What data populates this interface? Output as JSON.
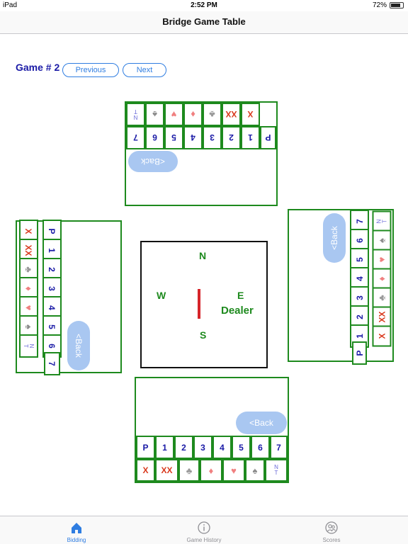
{
  "status": {
    "device": "iPad",
    "time": "2:52 PM",
    "battery": "72%"
  },
  "nav": {
    "title": "Bridge Game Table"
  },
  "game": {
    "label": "Game # 2",
    "previous": "Previous",
    "next": "Next"
  },
  "bids": {
    "numbers": [
      "P",
      "1",
      "2",
      "3",
      "4",
      "5",
      "6",
      "7"
    ],
    "double": "X",
    "redouble": "XX",
    "nt_n": "N",
    "nt_t": "T",
    "back": "<Back"
  },
  "suits": {
    "spade": "♠",
    "heart": "♥",
    "diamond": "♦",
    "club": "♣"
  },
  "compass": {
    "north": "N",
    "south": "S",
    "west": "W",
    "east": "E",
    "dealer": "Dealer"
  },
  "tabs": [
    {
      "label": "Bidding",
      "icon": "home-icon",
      "active": true
    },
    {
      "label": "Game History",
      "icon": "info-icon",
      "active": false
    },
    {
      "label": "Scores",
      "icon": "scores-icon",
      "active": false
    }
  ],
  "colors": {
    "green": "#1e8a1e",
    "blue_text": "#1a1aa6",
    "red_text": "#d93a1e",
    "accent": "#2f7de1",
    "back_pill": "#a9c7f1",
    "dealer_marker": "#d6252a"
  }
}
